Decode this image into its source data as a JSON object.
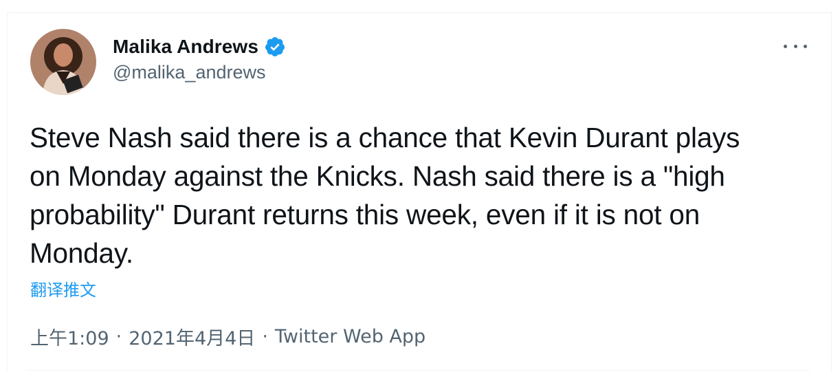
{
  "author": {
    "name": "Malika Andrews",
    "handle": "@malika_andrews",
    "verified_icon": "verified-badge-icon"
  },
  "more_icon": "more-options-icon",
  "tweet": {
    "text": "Steve Nash said there is a chance that Kevin Durant plays\non Monday against the Knicks. Nash said there is a \"high\nprobability\" Durant returns this week, even if it is not on\nMonday.",
    "translate_label": "翻译推文"
  },
  "meta": {
    "time": "上午1:09",
    "separator": "·",
    "date": "2021年4月4日",
    "source": "Twitter Web App"
  },
  "colors": {
    "text": "#0f1419",
    "secondary": "#536471",
    "accent": "#1d9bf0",
    "border": "#eff3f4"
  }
}
